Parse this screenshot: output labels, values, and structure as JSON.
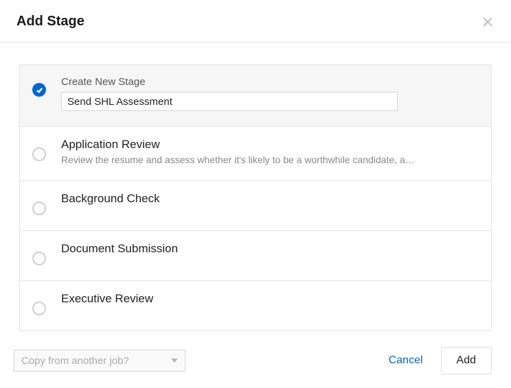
{
  "header": {
    "title": "Add Stage"
  },
  "options": {
    "create": {
      "label": "Create New Stage",
      "value": "Send SHL Assessment"
    },
    "app_review": {
      "title": "Application Review",
      "desc": "Review the resume and assess whether it's likely to be a worthwhile candidate, a…"
    },
    "bg_check": {
      "title": "Background Check"
    },
    "doc_sub": {
      "title": "Document Submission"
    },
    "exec_review": {
      "title": "Executive Review"
    }
  },
  "footer": {
    "copy_placeholder": "Copy from another job?",
    "cancel": "Cancel",
    "add": "Add"
  }
}
